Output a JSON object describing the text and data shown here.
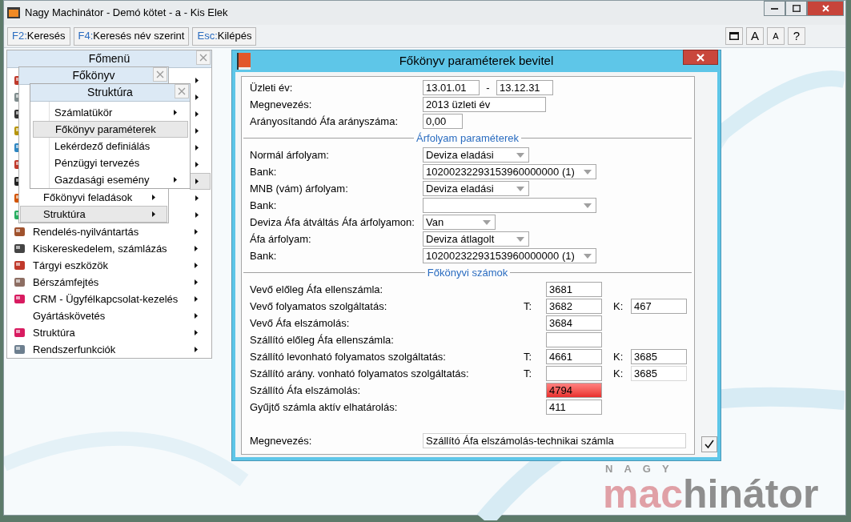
{
  "window": {
    "title": "Nagy Machinátor - Demó kötet - a - Kis Elek"
  },
  "toolbar": {
    "buttons": [
      {
        "key": "F2:",
        "label": "Keresés"
      },
      {
        "key": "F4:",
        "label": "Keresés név szerint"
      },
      {
        "key": "Esc:",
        "label": "Kilépés"
      }
    ],
    "right_buttons": [
      {
        "kind": "window"
      },
      {
        "kind": "text",
        "label": "A"
      },
      {
        "kind": "text",
        "label": "A"
      },
      {
        "kind": "text",
        "label": "?"
      }
    ]
  },
  "main_menu": {
    "title": "Főmenü",
    "items": [
      {
        "selected": false,
        "icon": true
      },
      {
        "selected": false,
        "icon": true
      },
      {
        "selected": false,
        "icon": true
      },
      {
        "selected": false,
        "icon": true
      },
      {
        "selected": false,
        "icon": true
      },
      {
        "selected": false,
        "icon": true
      },
      {
        "selected": true,
        "icon": true
      },
      {
        "selected": false,
        "icon": true
      },
      {
        "selected": false,
        "icon": true
      },
      {
        "label": "Rendelés-nyilvántartás",
        "selected": false,
        "icon": true
      },
      {
        "label": "Kiskereskedelem, számlázás",
        "selected": false,
        "icon": true
      },
      {
        "label": "Tárgyi eszközök",
        "selected": false,
        "icon": true
      },
      {
        "label": "Bérszámfejtés",
        "selected": false,
        "icon": true
      },
      {
        "label": "CRM - Ügyfélkapcsolat-kezelés",
        "selected": false,
        "icon": true
      },
      {
        "label": "Gyártáskövetés",
        "selected": false,
        "icon": false
      },
      {
        "label": "Struktúra",
        "selected": false,
        "icon": true
      },
      {
        "label": "Rendszerfunkciók",
        "selected": false,
        "icon": true
      }
    ]
  },
  "ledger_menu": {
    "title": "Főkönyv",
    "items": [
      {
        "label": "Főkönyvi feladások",
        "selected": false
      },
      {
        "label": "Struktúra",
        "selected": true
      }
    ]
  },
  "structure_menu": {
    "title": "Struktúra",
    "items": [
      {
        "label": "Számlatükör",
        "selected": false,
        "submenu": true
      },
      {
        "label": "Főkönyv paraméterek",
        "selected": true,
        "submenu": false
      },
      {
        "label": "Lekérdező definiálás",
        "selected": false,
        "submenu": false
      },
      {
        "label": "Pénzügyi tervezés",
        "selected": false,
        "submenu": false
      },
      {
        "label": "Gazdasági esemény",
        "selected": false,
        "submenu": true
      }
    ]
  },
  "dialog": {
    "title": "Főkönyv paraméterek bevitel",
    "rows": [
      {
        "kind": "range",
        "label": "Üzleti év:",
        "from": "13.01.01",
        "separator": "-",
        "to": "13.12.31"
      },
      {
        "kind": "text",
        "label": "Megnevezés:",
        "value": "2013 üzleti év"
      },
      {
        "kind": "text",
        "label": "Arányosítandó Áfa arányszáma:",
        "value": "0,00"
      },
      {
        "kind": "section",
        "label": "Árfolyam paraméterek"
      },
      {
        "kind": "dropdown",
        "label": "Normál árfolyam:",
        "value": "Deviza eladási"
      },
      {
        "kind": "dropdown",
        "label": "Bank:",
        "value": "10200232293153960000000 (1)"
      },
      {
        "kind": "dropdown",
        "label": "MNB (vám) árfolyam:",
        "value": "Deviza eladási"
      },
      {
        "kind": "dropdown",
        "label": "Bank:"
      },
      {
        "kind": "dropdown",
        "label": "Deviza Áfa átváltás Áfa árfolyamon:",
        "value": "Van"
      },
      {
        "kind": "dropdown",
        "label": "Áfa árfolyam:",
        "value": "Deviza átlagolt"
      },
      {
        "kind": "dropdown",
        "label": "Bank:",
        "value": "10200232293153960000000 (1)"
      },
      {
        "kind": "section",
        "label": "Főkönyvi számok"
      }
    ],
    "accounts": [
      {
        "label": "Vevő előleg Áfa ellenszámla:",
        "t": "3681",
        "error": false
      },
      {
        "label": "Vevő folyamatos szolgáltatás:",
        "t_prefix": "T:",
        "t": "3682",
        "k_prefix": "K:",
        "k": "467",
        "k_disabled": false,
        "error": false
      },
      {
        "label": "Vevő Áfa elszámolás:",
        "t": "3684",
        "error": false
      },
      {
        "label": "Szállító előleg Áfa ellenszámla:",
        "error": false
      },
      {
        "label": "Szállító levonható folyamatos szolgáltatás:",
        "t_prefix": "T:",
        "t": "4661",
        "k_prefix": "K:",
        "k": "3685",
        "k_disabled": false,
        "error": false
      },
      {
        "label": "Szállító arány. vonható folyamatos szolgáltatás:",
        "t_prefix": "T:",
        "k_prefix": "K:",
        "k": "3685",
        "k_disabled": true,
        "error": false
      },
      {
        "label": "Szállító Áfa elszámolás:",
        "t": "4794",
        "error": true
      },
      {
        "label": "Gyűjtő számla aktív elhatárolás:",
        "t": "411",
        "error": false
      }
    ],
    "name_row": {
      "label": "Megnevezés:",
      "value": "Szállító Áfa elszámolás-technikai számla"
    }
  },
  "logo": {
    "top": "NAGY",
    "accent": "mac",
    "rest": "hinátor"
  }
}
